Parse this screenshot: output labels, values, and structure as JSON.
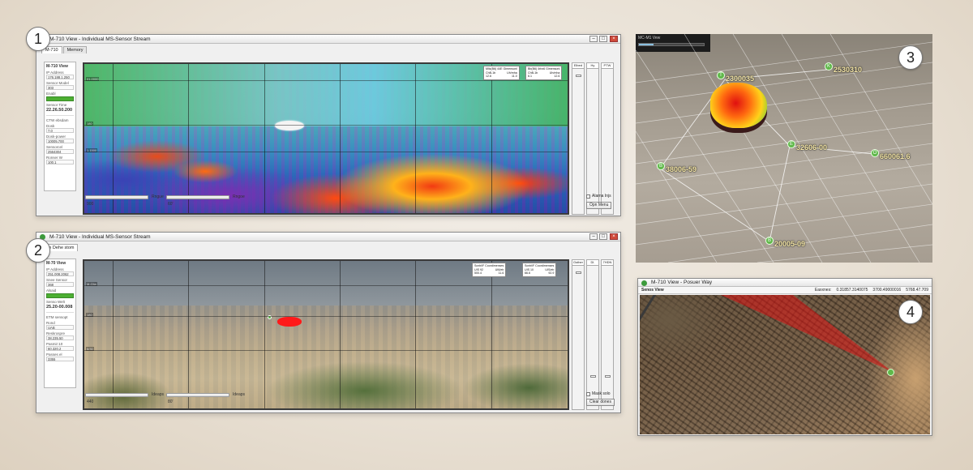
{
  "badges": [
    "1",
    "2",
    "3",
    "4"
  ],
  "window1": {
    "title": "M-710 View - Individual MS-Sensor Stream",
    "tabs": [
      "M-710",
      "Memory"
    ],
    "sidebar": {
      "title": "M-710 View",
      "ip_label": "IP Address",
      "ip_value": "176.188.1.250",
      "sensor_label": "Sensor Model",
      "sensor_value": "303",
      "status_label": "Enabl",
      "time_label": "Sensor Time",
      "time_value": "22.26.50.200",
      "section_title": "CTW ebsdam",
      "fields": [
        {
          "label": "Dosk",
          "value": "7.0"
        },
        {
          "label": "Dosk-power",
          "value": "10005.700"
        },
        {
          "label": "Sensorcel",
          "value": "2564304"
        },
        {
          "label": "Ronser W",
          "value": "100.1"
        }
      ]
    },
    "panel_ticks": [
      "01.0000",
      "180",
      "1.1500"
    ],
    "info_boxes": [
      {
        "title": "Mllc(B6) 44E Gimensonl",
        "cols": [
          "ChB-1b",
          "Uh/mha"
        ],
        "vals": [
          "12.6",
          "11.0"
        ]
      },
      {
        "title": "Bb(B6) 4rbx6 Gimensonl",
        "cols": [
          "ChB-1b",
          "Uh/mha"
        ],
        "vals": [
          "6.1",
          "12.6"
        ]
      }
    ],
    "right_cols": [
      "Elbed",
      "Hy",
      "PTW"
    ],
    "slider1_label": "Rngue",
    "slider1_value": "900",
    "slider2_label": "Rngoe",
    "slider2_value": "60'",
    "checkbox_label": "Alarna Injs",
    "button_label": "Opn Menu"
  },
  "window2": {
    "title": "M-710 View - Individual MS-Sensor Stream",
    "tabs": [
      "Ge Dehe stom"
    ],
    "sidebar": {
      "title": "M-70 View",
      "ip_label": "IP Address",
      "ip_value": "251.008.2062",
      "sensor_label": "Snee Sensor",
      "sensor_value": "368",
      "status_label": "Alsaid",
      "time_label": "Senso Welt",
      "time_value": "25.20-00.008",
      "section_title": "ETM sensopt",
      "fields": [
        {
          "label": "Rond",
          "value": "UAB"
        },
        {
          "label": "Reskrospre",
          "value": "38.235.50"
        },
        {
          "label": "Pasmir:10",
          "value": "60.320.2"
        },
        {
          "label": "Passes el",
          "value": "3355"
        }
      ]
    },
    "panel_ticks": [
      "M-Clla",
      "180",
      "6/30"
    ],
    "info_boxes": [
      {
        "title": "Scnbl/F Coordimenses",
        "cols": [
          "UIS 92",
          "UI6/eb"
        ],
        "vals": [
          "500.4",
          "11.6"
        ]
      },
      {
        "title": "Scnbl/F Coordimenses",
        "cols": [
          "UIS 10",
          "UIS/eb"
        ],
        "vals": [
          "66.6",
          "92.9"
        ]
      }
    ],
    "right_cols": [
      "Gsther",
      "Dl.",
      "7HDN"
    ],
    "slider1_label": "Ideaps",
    "slider1_value": "440",
    "slider2_label": "Ideaps",
    "slider2_value": "80'",
    "checkbox_label": "Mask solo",
    "button_label": "Clear dones"
  },
  "window3": {
    "title": "MC-M1 Vew",
    "pins": [
      {
        "letter": "T",
        "label": "2300035"
      },
      {
        "letter": "K",
        "label": "2530310"
      },
      {
        "letter": "E",
        "label": "32606-00"
      },
      {
        "letter": "O",
        "label": "660061.6"
      },
      {
        "letter": "B",
        "label": "38006-59"
      },
      {
        "letter": "B",
        "label": "20005-09"
      }
    ]
  },
  "window4": {
    "title": "M-710 View - Posuer Way",
    "header_left": "Senos View",
    "header_label": "Eaxxnes:",
    "coords": [
      "0.31857.3140075",
      "3700.49000016",
      "5768.47.709"
    ]
  },
  "colors": {
    "status_green": "#4caf32",
    "pin_green": "#5fb84a",
    "hotspot_red": "#e01010",
    "close_red": "#d04a3a"
  }
}
